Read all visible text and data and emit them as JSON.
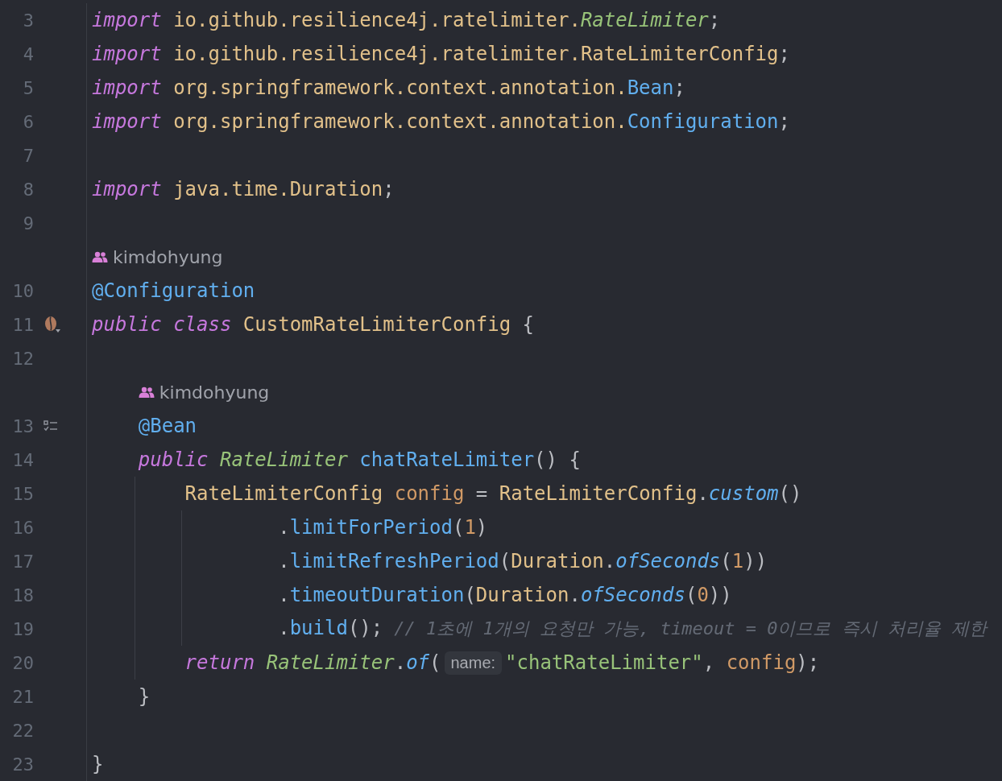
{
  "lines": [
    {
      "number": "3",
      "tokens": [
        {
          "kind": "kw",
          "text": "import"
        },
        {
          "kind": "pkg",
          "text": " io.github.resilience4j.ratelimiter."
        },
        {
          "kind": "type",
          "text": "RateLimiter"
        },
        {
          "kind": "punc",
          "text": ";"
        }
      ]
    },
    {
      "number": "4",
      "tokens": [
        {
          "kind": "kw",
          "text": "import"
        },
        {
          "kind": "pkg",
          "text": " io.github.resilience4j.ratelimiter.RateLimiterConfig"
        },
        {
          "kind": "punc",
          "text": ";"
        }
      ]
    },
    {
      "number": "5",
      "tokens": [
        {
          "kind": "kw",
          "text": "import"
        },
        {
          "kind": "pkg",
          "text": " org.springframework.context.annotation."
        },
        {
          "kind": "ann",
          "text": "Bean"
        },
        {
          "kind": "punc",
          "text": ";"
        }
      ]
    },
    {
      "number": "6",
      "tokens": [
        {
          "kind": "kw",
          "text": "import"
        },
        {
          "kind": "pkg",
          "text": " org.springframework.context.annotation."
        },
        {
          "kind": "ann",
          "text": "Configuration"
        },
        {
          "kind": "punc",
          "text": ";"
        }
      ]
    },
    {
      "number": "7"
    },
    {
      "number": "8",
      "tokens": [
        {
          "kind": "kw",
          "text": "import"
        },
        {
          "kind": "pkg",
          "text": " java.time.Duration"
        },
        {
          "kind": "punc",
          "text": ";"
        }
      ]
    },
    {
      "number": "9"
    },
    {
      "number": "10",
      "author": "kimdohyung",
      "tokens": [
        {
          "kind": "ann",
          "text": "@Configuration"
        }
      ]
    },
    {
      "number": "11",
      "gutter": {
        "kind": "bean"
      },
      "tokens": [
        {
          "kind": "kw",
          "text": "public class"
        },
        {
          "kind": "plain",
          "text": " CustomRateLimiterConfig"
        },
        {
          "kind": "punc",
          "text": " {"
        }
      ]
    },
    {
      "number": "12"
    },
    {
      "number": "13",
      "author": "kimdohyung",
      "gutter": {
        "kind": "checklist"
      },
      "indent": {
        "kind": "member"
      },
      "tokens": [
        {
          "kind": "ann",
          "text": "@Bean"
        }
      ]
    },
    {
      "number": "14",
      "indent": {
        "kind": "member"
      },
      "tokens": [
        {
          "kind": "kw",
          "text": "public"
        },
        {
          "kind": "type",
          "text": " RateLimiter"
        },
        {
          "kind": "fn",
          "text": " chatRateLimiter"
        },
        {
          "kind": "punc",
          "text": "() {"
        }
      ]
    },
    {
      "number": "15",
      "indent": {
        "kind": "body"
      },
      "tokens": [
        {
          "kind": "plain",
          "text": "RateLimiterConfig"
        },
        {
          "kind": "var",
          "text": " config"
        },
        {
          "kind": "punc",
          "text": " = "
        },
        {
          "kind": "plain",
          "text": "RateLimiterConfig"
        },
        {
          "kind": "punc",
          "text": "."
        },
        {
          "kind": "sfn",
          "text": "custom"
        },
        {
          "kind": "punc",
          "text": "()"
        }
      ]
    },
    {
      "number": "16",
      "indent": {
        "kind": "chain"
      },
      "tokens": [
        {
          "kind": "punc",
          "text": "."
        },
        {
          "kind": "fn",
          "text": "limitForPeriod"
        },
        {
          "kind": "punc",
          "text": "("
        },
        {
          "kind": "num",
          "text": "1"
        },
        {
          "kind": "punc",
          "text": ")"
        }
      ]
    },
    {
      "number": "17",
      "indent": {
        "kind": "chain"
      },
      "tokens": [
        {
          "kind": "punc",
          "text": "."
        },
        {
          "kind": "fn",
          "text": "limitRefreshPeriod"
        },
        {
          "kind": "punc",
          "text": "("
        },
        {
          "kind": "plain",
          "text": "Duration"
        },
        {
          "kind": "punc",
          "text": "."
        },
        {
          "kind": "sfn",
          "text": "ofSeconds"
        },
        {
          "kind": "punc",
          "text": "("
        },
        {
          "kind": "num",
          "text": "1"
        },
        {
          "kind": "punc",
          "text": "))"
        }
      ]
    },
    {
      "number": "18",
      "indent": {
        "kind": "chain"
      },
      "tokens": [
        {
          "kind": "punc",
          "text": "."
        },
        {
          "kind": "fn",
          "text": "timeoutDuration"
        },
        {
          "kind": "punc",
          "text": "("
        },
        {
          "kind": "plain",
          "text": "Duration"
        },
        {
          "kind": "punc",
          "text": "."
        },
        {
          "kind": "sfn",
          "text": "ofSeconds"
        },
        {
          "kind": "punc",
          "text": "("
        },
        {
          "kind": "num",
          "text": "0"
        },
        {
          "kind": "punc",
          "text": "))"
        }
      ]
    },
    {
      "number": "19",
      "indent": {
        "kind": "chain"
      },
      "tokens": [
        {
          "kind": "punc",
          "text": "."
        },
        {
          "kind": "fn",
          "text": "build"
        },
        {
          "kind": "punc",
          "text": "();"
        },
        {
          "kind": "comment",
          "text": "// 1초에 1개의 요청만 가능, timeout = 0이므로 즉시 처리율 제한"
        }
      ]
    },
    {
      "number": "20",
      "indent": {
        "kind": "body"
      },
      "tokens": [
        {
          "kind": "kw",
          "text": "return"
        },
        {
          "kind": "type",
          "text": " RateLimiter"
        },
        {
          "kind": "punc",
          "text": "."
        },
        {
          "kind": "sfn",
          "text": "of"
        },
        {
          "kind": "punc",
          "text": "("
        },
        {
          "kind": "hint",
          "text": "name:"
        },
        {
          "kind": "str",
          "text": "\"chatRateLimiter\""
        },
        {
          "kind": "punc",
          "text": ", "
        },
        {
          "kind": "var",
          "text": "config"
        },
        {
          "kind": "punc",
          "text": ");"
        }
      ]
    },
    {
      "number": "21",
      "indent": {
        "kind": "member"
      },
      "tokens": [
        {
          "kind": "punc",
          "text": "}"
        }
      ]
    },
    {
      "number": "22"
    },
    {
      "number": "23",
      "tokens": [
        {
          "kind": "punc",
          "text": "}"
        }
      ]
    }
  ]
}
